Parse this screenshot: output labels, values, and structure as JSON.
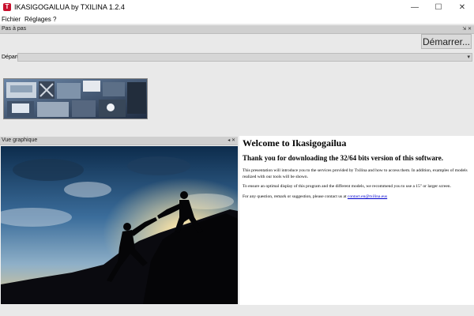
{
  "window": {
    "app_icon_glyph": "T",
    "title": "IKASIGOGAILUA by TXILINA 1.2.4",
    "controls": {
      "minimize": "—",
      "maximize": "☐",
      "close": "✕"
    }
  },
  "menu": {
    "items": [
      "Fichier",
      "Réglages",
      "?"
    ]
  },
  "step_panel": {
    "header": "Pas à pas",
    "header_buttons": "⇲ ✕",
    "start_button": "Démarrer...",
    "depart_label": "Départ",
    "depart_value": "",
    "dropdown_arrow": "▾"
  },
  "graph_panel": {
    "header": "Vue graphique",
    "header_buttons": "◂ ✕"
  },
  "welcome": {
    "title": "Welcome to Ikasigogailua",
    "subtitle": "Thank you for downloading the 32/64 bits version of this software.",
    "para1": "This presentation will introduce you to the services provided by Txilina and how to access them. In addition, examples of models realized with our tools will be shown.",
    "para2": "To ensure an optimal display of this program and the different models, we recommend you to use a 15\" or larger screen.",
    "para3_prefix": "For any question, remark or suggestion, please contact us at ",
    "contact_email": "contact.en@txilina.eus"
  },
  "colors": {
    "title_bar": "#ffffff",
    "panel_header": "#cfcfcf",
    "background": "#e9e9e9",
    "app_icon": "#c8102e",
    "link": "#0000cc"
  },
  "icons": {
    "app": "app-logo-icon",
    "panel_float": "float-icon",
    "panel_close": "close-icon"
  }
}
